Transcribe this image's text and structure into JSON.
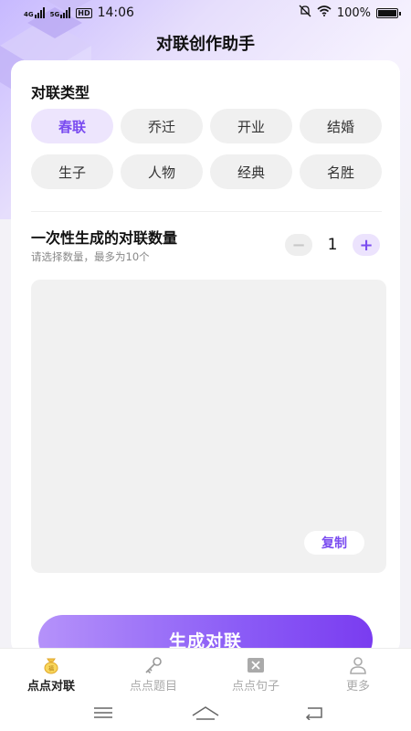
{
  "status_bar": {
    "network_1": "4G",
    "network_2": "5G",
    "hd": "HD",
    "time": "14:06",
    "battery": "100%"
  },
  "header": {
    "title": "对联创作助手"
  },
  "couplet_type": {
    "title": "对联类型",
    "options": [
      "春联",
      "乔迁",
      "开业",
      "结婚",
      "生子",
      "人物",
      "经典",
      "名胜"
    ],
    "selected": "春联"
  },
  "quantity": {
    "title": "一次性生成的对联数量",
    "hint": "请选择数量，最多为10个",
    "value": "1",
    "minus_label": "−",
    "plus_label": "+"
  },
  "result": {
    "copy_label": "复制"
  },
  "generate_label": "生成对联",
  "bottom_nav": {
    "items": [
      {
        "label": "点点对联",
        "icon": "bag-icon",
        "active": true
      },
      {
        "label": "点点题目",
        "icon": "key-icon",
        "active": false
      },
      {
        "label": "点点句子",
        "icon": "x-box-icon",
        "active": false
      },
      {
        "label": "更多",
        "icon": "person-icon",
        "active": false
      }
    ]
  },
  "colors": {
    "accent": "#7a4cf0",
    "chip_active_bg": "#ede5fd"
  }
}
